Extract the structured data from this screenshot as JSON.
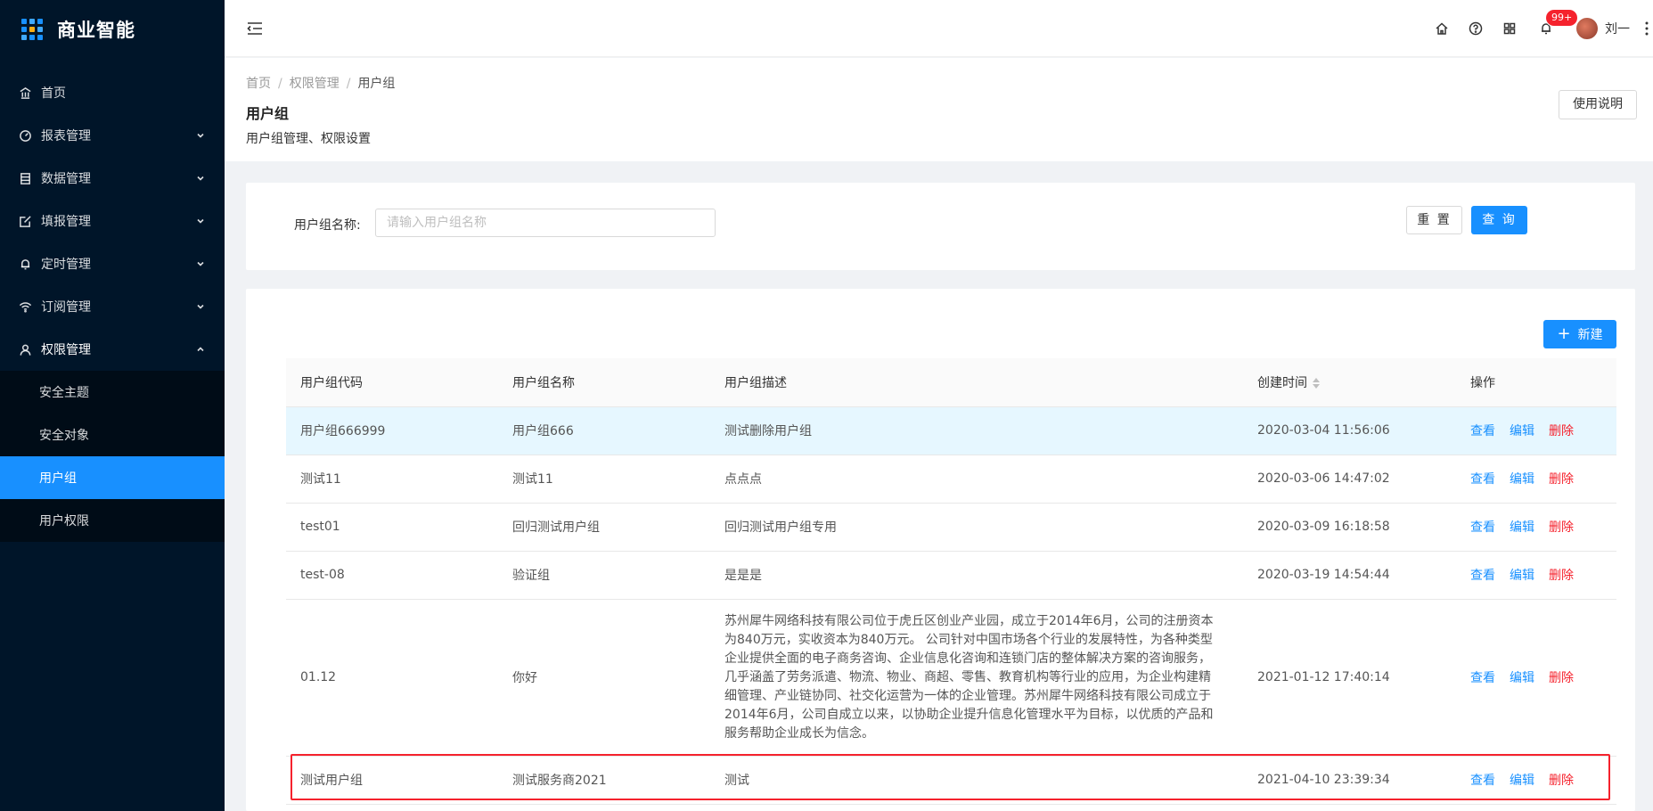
{
  "app": {
    "title": "商业智能"
  },
  "sidebar": {
    "items": [
      {
        "label": "首页",
        "icon": "bank-icon",
        "has_arrow": false
      },
      {
        "label": "报表管理",
        "icon": "dashboard-icon",
        "has_arrow": true,
        "arrow": "down"
      },
      {
        "label": "数据管理",
        "icon": "database-icon",
        "has_arrow": true,
        "arrow": "down"
      },
      {
        "label": "填报管理",
        "icon": "form-icon",
        "has_arrow": true,
        "arrow": "down"
      },
      {
        "label": "定时管理",
        "icon": "bell-icon",
        "has_arrow": true,
        "arrow": "down"
      },
      {
        "label": "订阅管理",
        "icon": "wifi-icon",
        "has_arrow": true,
        "arrow": "down"
      },
      {
        "label": "权限管理",
        "icon": "user-icon",
        "has_arrow": true,
        "arrow": "up"
      }
    ],
    "sub_items": [
      {
        "label": "安全主题",
        "active": false
      },
      {
        "label": "安全对象",
        "active": false
      },
      {
        "label": "用户组",
        "active": true
      },
      {
        "label": "用户权限",
        "active": false
      }
    ]
  },
  "header": {
    "notification_badge": "99+",
    "username": "刘一"
  },
  "breadcrumb": [
    "首页",
    "权限管理",
    "用户组"
  ],
  "page": {
    "title": "用户组",
    "description": "用户组管理、权限设置",
    "help_button": "使用说明"
  },
  "search": {
    "label": "用户组名称:",
    "placeholder": "请输入用户组名称",
    "value": "",
    "reset_button": "重 置",
    "query_button": "查 询"
  },
  "table": {
    "new_button": "新建",
    "columns": [
      "用户组代码",
      "用户组名称",
      "用户组描述",
      "创建时间",
      "操作"
    ],
    "actions": {
      "view": "查看",
      "edit": "编辑",
      "delete": "删除"
    },
    "rows": [
      {
        "code": "用户组666999",
        "name": "用户组666",
        "desc": "测试删除用户组",
        "created": "2020-03-04 11:56:06"
      },
      {
        "code": "测试11",
        "name": "测试11",
        "desc": "点点点",
        "created": "2020-03-06 14:47:02"
      },
      {
        "code": "test01",
        "name": "回归测试用户组",
        "desc": "回归测试用户组专用",
        "created": "2020-03-09 16:18:58"
      },
      {
        "code": "test-08",
        "name": "验证组",
        "desc": "是是是",
        "created": "2020-03-19 14:54:44"
      },
      {
        "code": "01.12",
        "name": "你好",
        "desc": "苏州犀牛网络科技有限公司位于虎丘区创业产业园，成立于2014年6月，公司的注册资本为840万元，实收资本为840万元。 公司针对中国市场各个行业的发展特性，为各种类型企业提供全面的电子商务咨询、企业信息化咨询和连锁门店的整体解决方案的咨询服务，几乎涵盖了劳务派遣、物流、物业、商超、零售、教育机构等行业的应用，为企业构建精细管理、产业链协同、社交化运营为一体的企业管理。苏州犀牛网络科技有限公司成立于2014年6月，公司自成立以来，以协助企业提升信息化管理水平为目标，以优质的产品和服务帮助企业成长为信念。",
        "created": "2021-01-12 17:40:14"
      },
      {
        "code": "测试用户组",
        "name": "测试服务商2021",
        "desc": "测试",
        "created": "2021-04-10 23:39:34"
      }
    ]
  },
  "colors": {
    "primary": "#1890ff",
    "sidebar_bg": "#001529",
    "danger": "#f5222d",
    "highlight_row": "#e6f7ff"
  }
}
